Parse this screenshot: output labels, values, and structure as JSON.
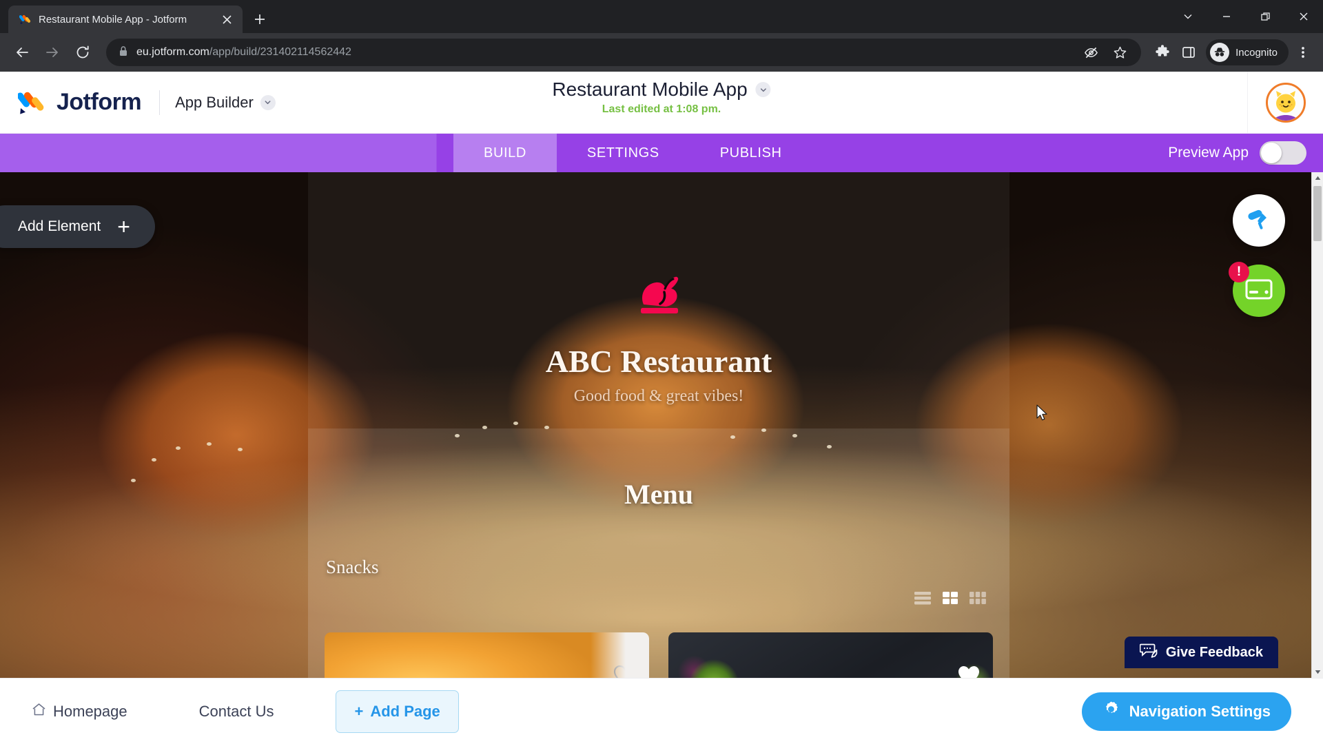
{
  "browser": {
    "tab": {
      "title": "Restaurant Mobile App - Jotform",
      "favicon_icon": "jotform-favicon",
      "close_icon": "close-icon"
    },
    "new_tab_icon": "plus-icon",
    "window_controls": [
      {
        "name": "tab-search",
        "icon": "chevron-down-icon"
      },
      {
        "name": "minimize",
        "icon": "minimize-icon"
      },
      {
        "name": "maximize",
        "icon": "restore-icon"
      },
      {
        "name": "close",
        "icon": "close-icon"
      }
    ],
    "nav": {
      "back_icon": "arrow-left-icon",
      "forward_icon": "arrow-right-icon",
      "reload_icon": "reload-icon"
    },
    "omnibox": {
      "lock_icon": "lock-icon",
      "url_host": "eu.jotform.com",
      "url_path": "/app/build/231402114562442",
      "full_url": "eu.jotform.com/app/build/231402114562442"
    },
    "toolbar_icons": [
      {
        "name": "tracking-protection-icon",
        "glyph": "eye-slash-icon"
      },
      {
        "name": "bookmark-icon",
        "glyph": "star-icon"
      },
      {
        "name": "extensions-icon",
        "glyph": "puzzle-icon"
      },
      {
        "name": "side-panel-icon",
        "glyph": "panel-icon"
      }
    ],
    "incognito": {
      "label": "Incognito",
      "icon": "incognito-icon"
    },
    "menu_icon": "three-dot-menu-icon"
  },
  "header": {
    "logo_text": "Jotform",
    "logo_icon": "jotform-logo-icon",
    "product": "App Builder",
    "product_chevron_icon": "chevron-down-icon",
    "app_title": "Restaurant Mobile App",
    "app_title_chevron_icon": "chevron-down-icon",
    "last_edited": "Last edited at 1:08 pm.",
    "avatar_icon": "cat-avatar"
  },
  "nav": {
    "tabs": [
      {
        "label": "BUILD",
        "active": true
      },
      {
        "label": "SETTINGS",
        "active": false
      },
      {
        "label": "PUBLISH",
        "active": false
      }
    ],
    "preview_label": "Preview App",
    "preview_enabled": false,
    "active_color": "#b77ff0",
    "bar_color": "#9641e6"
  },
  "canvas": {
    "add_element_label": "Add Element",
    "add_element_plus": "+",
    "fab_theme_icon": "paint-roller-icon",
    "fab_payment_icon": "credit-card-icon",
    "fab_payment_badge": "!",
    "fab_payment_color": "#74d329",
    "fab_badge_color": "#e8114b"
  },
  "app_preview": {
    "logo_icon": "roast-chicken-icon",
    "logo_color": "#f5074f",
    "restaurant_name": "ABC Restaurant",
    "tagline": "Good food & great vibes!",
    "menu_heading": "Menu",
    "category": "Snacks",
    "view_modes": [
      {
        "name": "list-view-icon",
        "active": false
      },
      {
        "name": "grid-2-view-icon",
        "active": true
      },
      {
        "name": "grid-3-view-icon",
        "active": false
      }
    ],
    "cards": [
      {
        "name": "menu-card-fries",
        "favorite_icon": "heart-outline-icon",
        "favorited": false
      },
      {
        "name": "menu-card-salad",
        "favorite_icon": "heart-filled-icon",
        "favorited": true
      }
    ]
  },
  "feedback": {
    "label": "Give Feedback",
    "icon": "feedback-icon",
    "color": "#0a1551"
  },
  "bottom_bar": {
    "pages": [
      {
        "label": "Homepage",
        "icon": "home-icon"
      },
      {
        "label": "Contact Us",
        "icon": null
      }
    ],
    "add_page_label": "Add Page",
    "add_page_plus": "+",
    "nav_settings_label": "Navigation Settings",
    "nav_settings_icon": "gear-icon",
    "nav_settings_color": "#2ba3f0"
  },
  "scrollbar": {
    "up_icon": "caret-up-icon",
    "down_icon": "caret-down-icon"
  },
  "cursor": {
    "icon": "pointer-cursor"
  }
}
